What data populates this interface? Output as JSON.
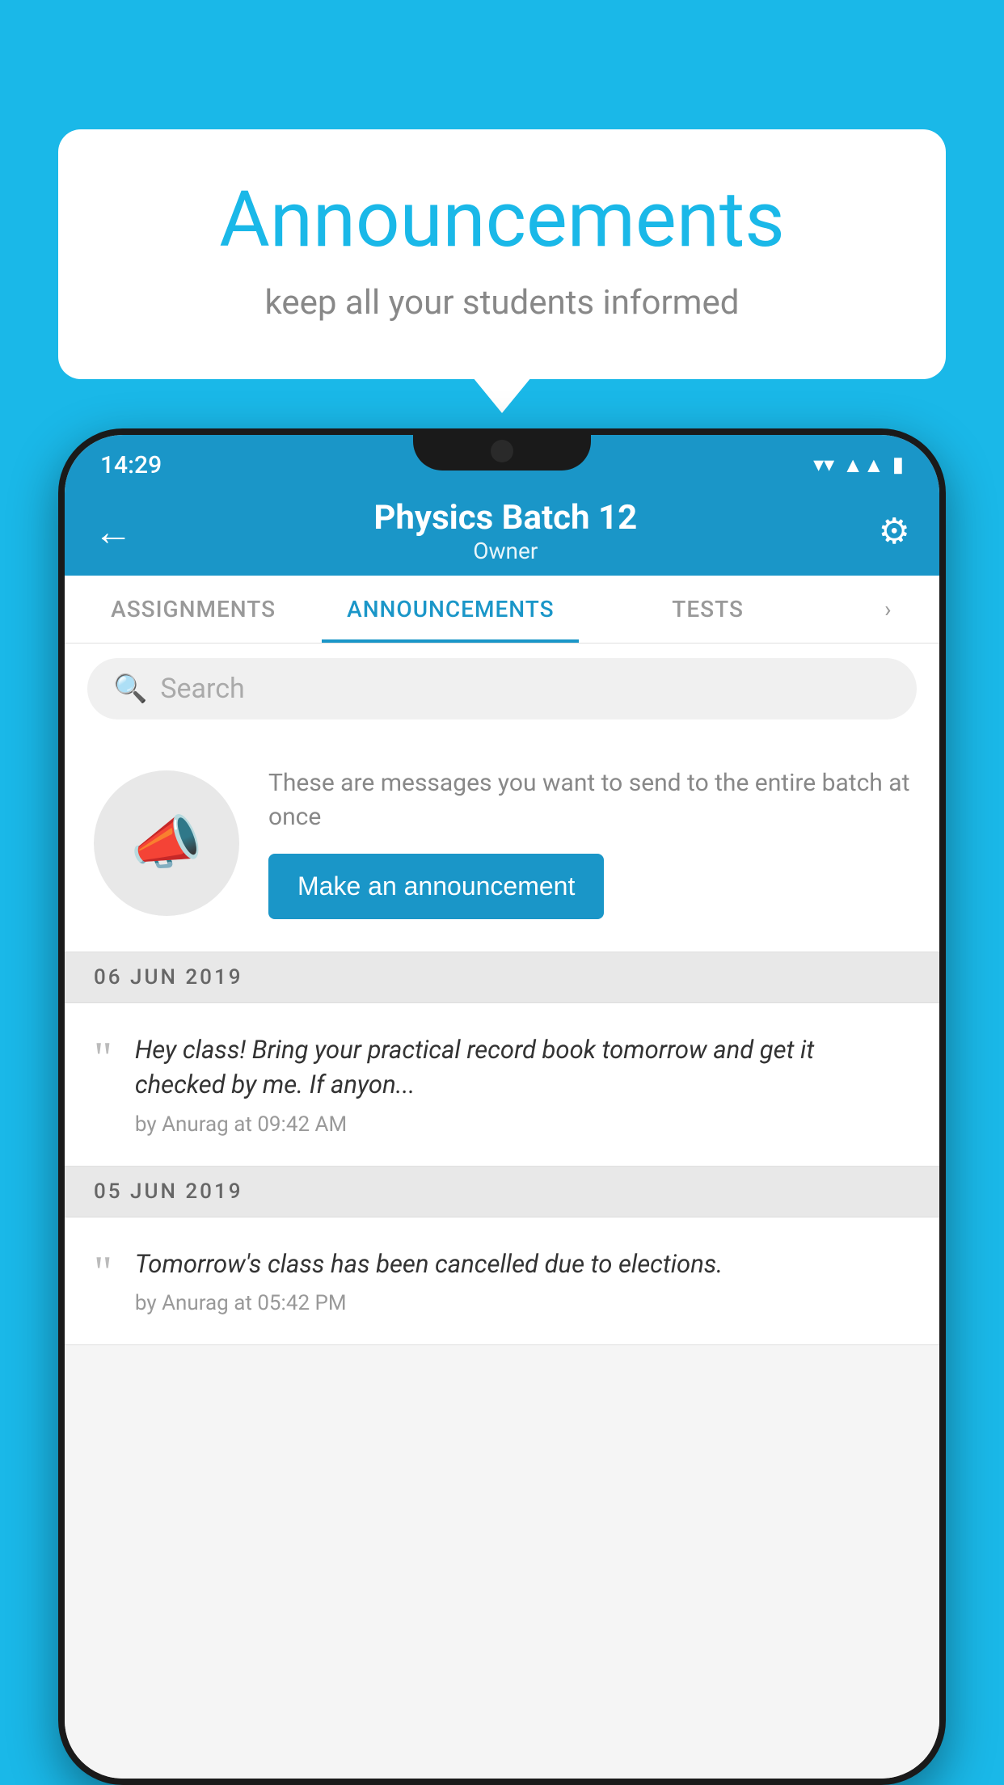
{
  "background_color": "#1ab8e8",
  "speech_bubble": {
    "title": "Announcements",
    "subtitle": "keep all your students informed"
  },
  "phone": {
    "status_bar": {
      "time": "14:29",
      "icons": [
        "wifi",
        "signal",
        "battery"
      ]
    },
    "app_bar": {
      "title": "Physics Batch 12",
      "subtitle": "Owner",
      "back_label": "←",
      "settings_label": "⚙"
    },
    "tabs": [
      {
        "label": "ASSIGNMENTS",
        "active": false
      },
      {
        "label": "ANNOUNCEMENTS",
        "active": true
      },
      {
        "label": "TESTS",
        "active": false
      }
    ],
    "search": {
      "placeholder": "Search"
    },
    "promo_card": {
      "description_text": "These are messages you want to send to the entire batch at once",
      "button_label": "Make an announcement"
    },
    "announcements": [
      {
        "date": "06  JUN  2019",
        "items": [
          {
            "text": "Hey class! Bring your practical record book tomorrow and get it checked by me. If anyon...",
            "meta": "by Anurag at 09:42 AM"
          }
        ]
      },
      {
        "date": "05  JUN  2019",
        "items": [
          {
            "text": "Tomorrow's class has been cancelled due to elections.",
            "meta": "by Anurag at 05:42 PM"
          }
        ]
      }
    ]
  }
}
